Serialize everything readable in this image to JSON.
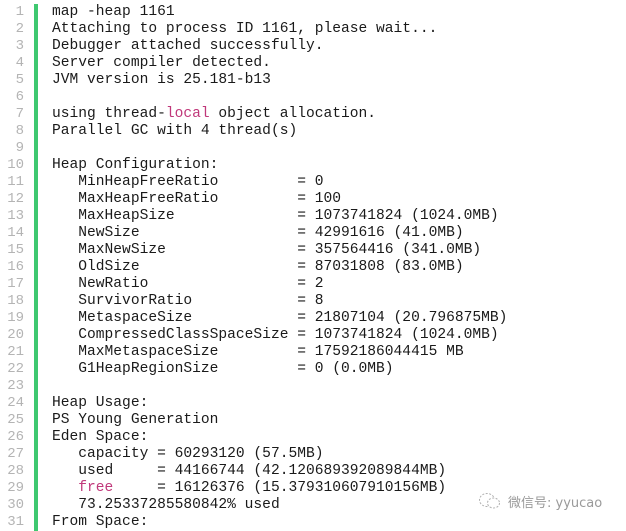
{
  "editor": {
    "lines": [
      {
        "n": "1",
        "parts": [
          {
            "t": "map -heap 1161"
          }
        ]
      },
      {
        "n": "2",
        "parts": [
          {
            "t": "Attaching to process ID 1161, please wait..."
          }
        ]
      },
      {
        "n": "3",
        "parts": [
          {
            "t": "Debugger attached successfully."
          }
        ]
      },
      {
        "n": "4",
        "parts": [
          {
            "t": "Server compiler detected."
          }
        ]
      },
      {
        "n": "5",
        "parts": [
          {
            "t": "JVM version is 25.181-b13"
          }
        ]
      },
      {
        "n": "6",
        "parts": [
          {
            "t": ""
          }
        ]
      },
      {
        "n": "7",
        "parts": [
          {
            "t": "using thread-"
          },
          {
            "t": "local",
            "kw": true
          },
          {
            "t": " object allocation."
          }
        ]
      },
      {
        "n": "8",
        "parts": [
          {
            "t": "Parallel GC with 4 thread(s)"
          }
        ]
      },
      {
        "n": "9",
        "parts": [
          {
            "t": ""
          }
        ]
      },
      {
        "n": "10",
        "parts": [
          {
            "t": "Heap Configuration:"
          }
        ]
      },
      {
        "n": "11",
        "parts": [
          {
            "t": "   MinHeapFreeRatio         = 0"
          }
        ]
      },
      {
        "n": "12",
        "parts": [
          {
            "t": "   MaxHeapFreeRatio         = 100"
          }
        ]
      },
      {
        "n": "13",
        "parts": [
          {
            "t": "   MaxHeapSize              = 1073741824 (1024.0MB)"
          }
        ]
      },
      {
        "n": "14",
        "parts": [
          {
            "t": "   NewSize                  = 42991616 (41.0MB)"
          }
        ]
      },
      {
        "n": "15",
        "parts": [
          {
            "t": "   MaxNewSize               = 357564416 (341.0MB)"
          }
        ]
      },
      {
        "n": "16",
        "parts": [
          {
            "t": "   OldSize                  = 87031808 (83.0MB)"
          }
        ]
      },
      {
        "n": "17",
        "parts": [
          {
            "t": "   NewRatio                 = 2"
          }
        ]
      },
      {
        "n": "18",
        "parts": [
          {
            "t": "   SurvivorRatio            = 8"
          }
        ]
      },
      {
        "n": "19",
        "parts": [
          {
            "t": "   MetaspaceSize            = 21807104 (20.796875MB)"
          }
        ]
      },
      {
        "n": "20",
        "parts": [
          {
            "t": "   CompressedClassSpaceSize = 1073741824 (1024.0MB)"
          }
        ]
      },
      {
        "n": "21",
        "parts": [
          {
            "t": "   MaxMetaspaceSize         = 17592186044415 MB"
          }
        ]
      },
      {
        "n": "22",
        "parts": [
          {
            "t": "   G1HeapRegionSize         = 0 (0.0MB)"
          }
        ]
      },
      {
        "n": "23",
        "parts": [
          {
            "t": ""
          }
        ]
      },
      {
        "n": "24",
        "parts": [
          {
            "t": "Heap Usage:"
          }
        ]
      },
      {
        "n": "25",
        "parts": [
          {
            "t": "PS Young Generation"
          }
        ]
      },
      {
        "n": "26",
        "parts": [
          {
            "t": "Eden Space:"
          }
        ]
      },
      {
        "n": "27",
        "parts": [
          {
            "t": "   capacity = 60293120 (57.5MB)"
          }
        ]
      },
      {
        "n": "28",
        "parts": [
          {
            "t": "   used     = 44166744 (42.120689392089844MB)"
          }
        ]
      },
      {
        "n": "29",
        "parts": [
          {
            "t": "   "
          },
          {
            "t": "free",
            "kw": true
          },
          {
            "t": "     = 16126376 (15.379310607910156MB)"
          }
        ]
      },
      {
        "n": "30",
        "parts": [
          {
            "t": "   73.25337285580842% used"
          }
        ]
      },
      {
        "n": "31",
        "parts": [
          {
            "t": "From Space:"
          }
        ]
      }
    ]
  },
  "watermark": {
    "icon": "wechat-icon",
    "text": "微信号: yyucao"
  },
  "colors": {
    "gutter_bar": "#3ec870",
    "keyword": "#c0387a",
    "line_number": "#b4b4b4",
    "text": "#1a1a1a"
  }
}
